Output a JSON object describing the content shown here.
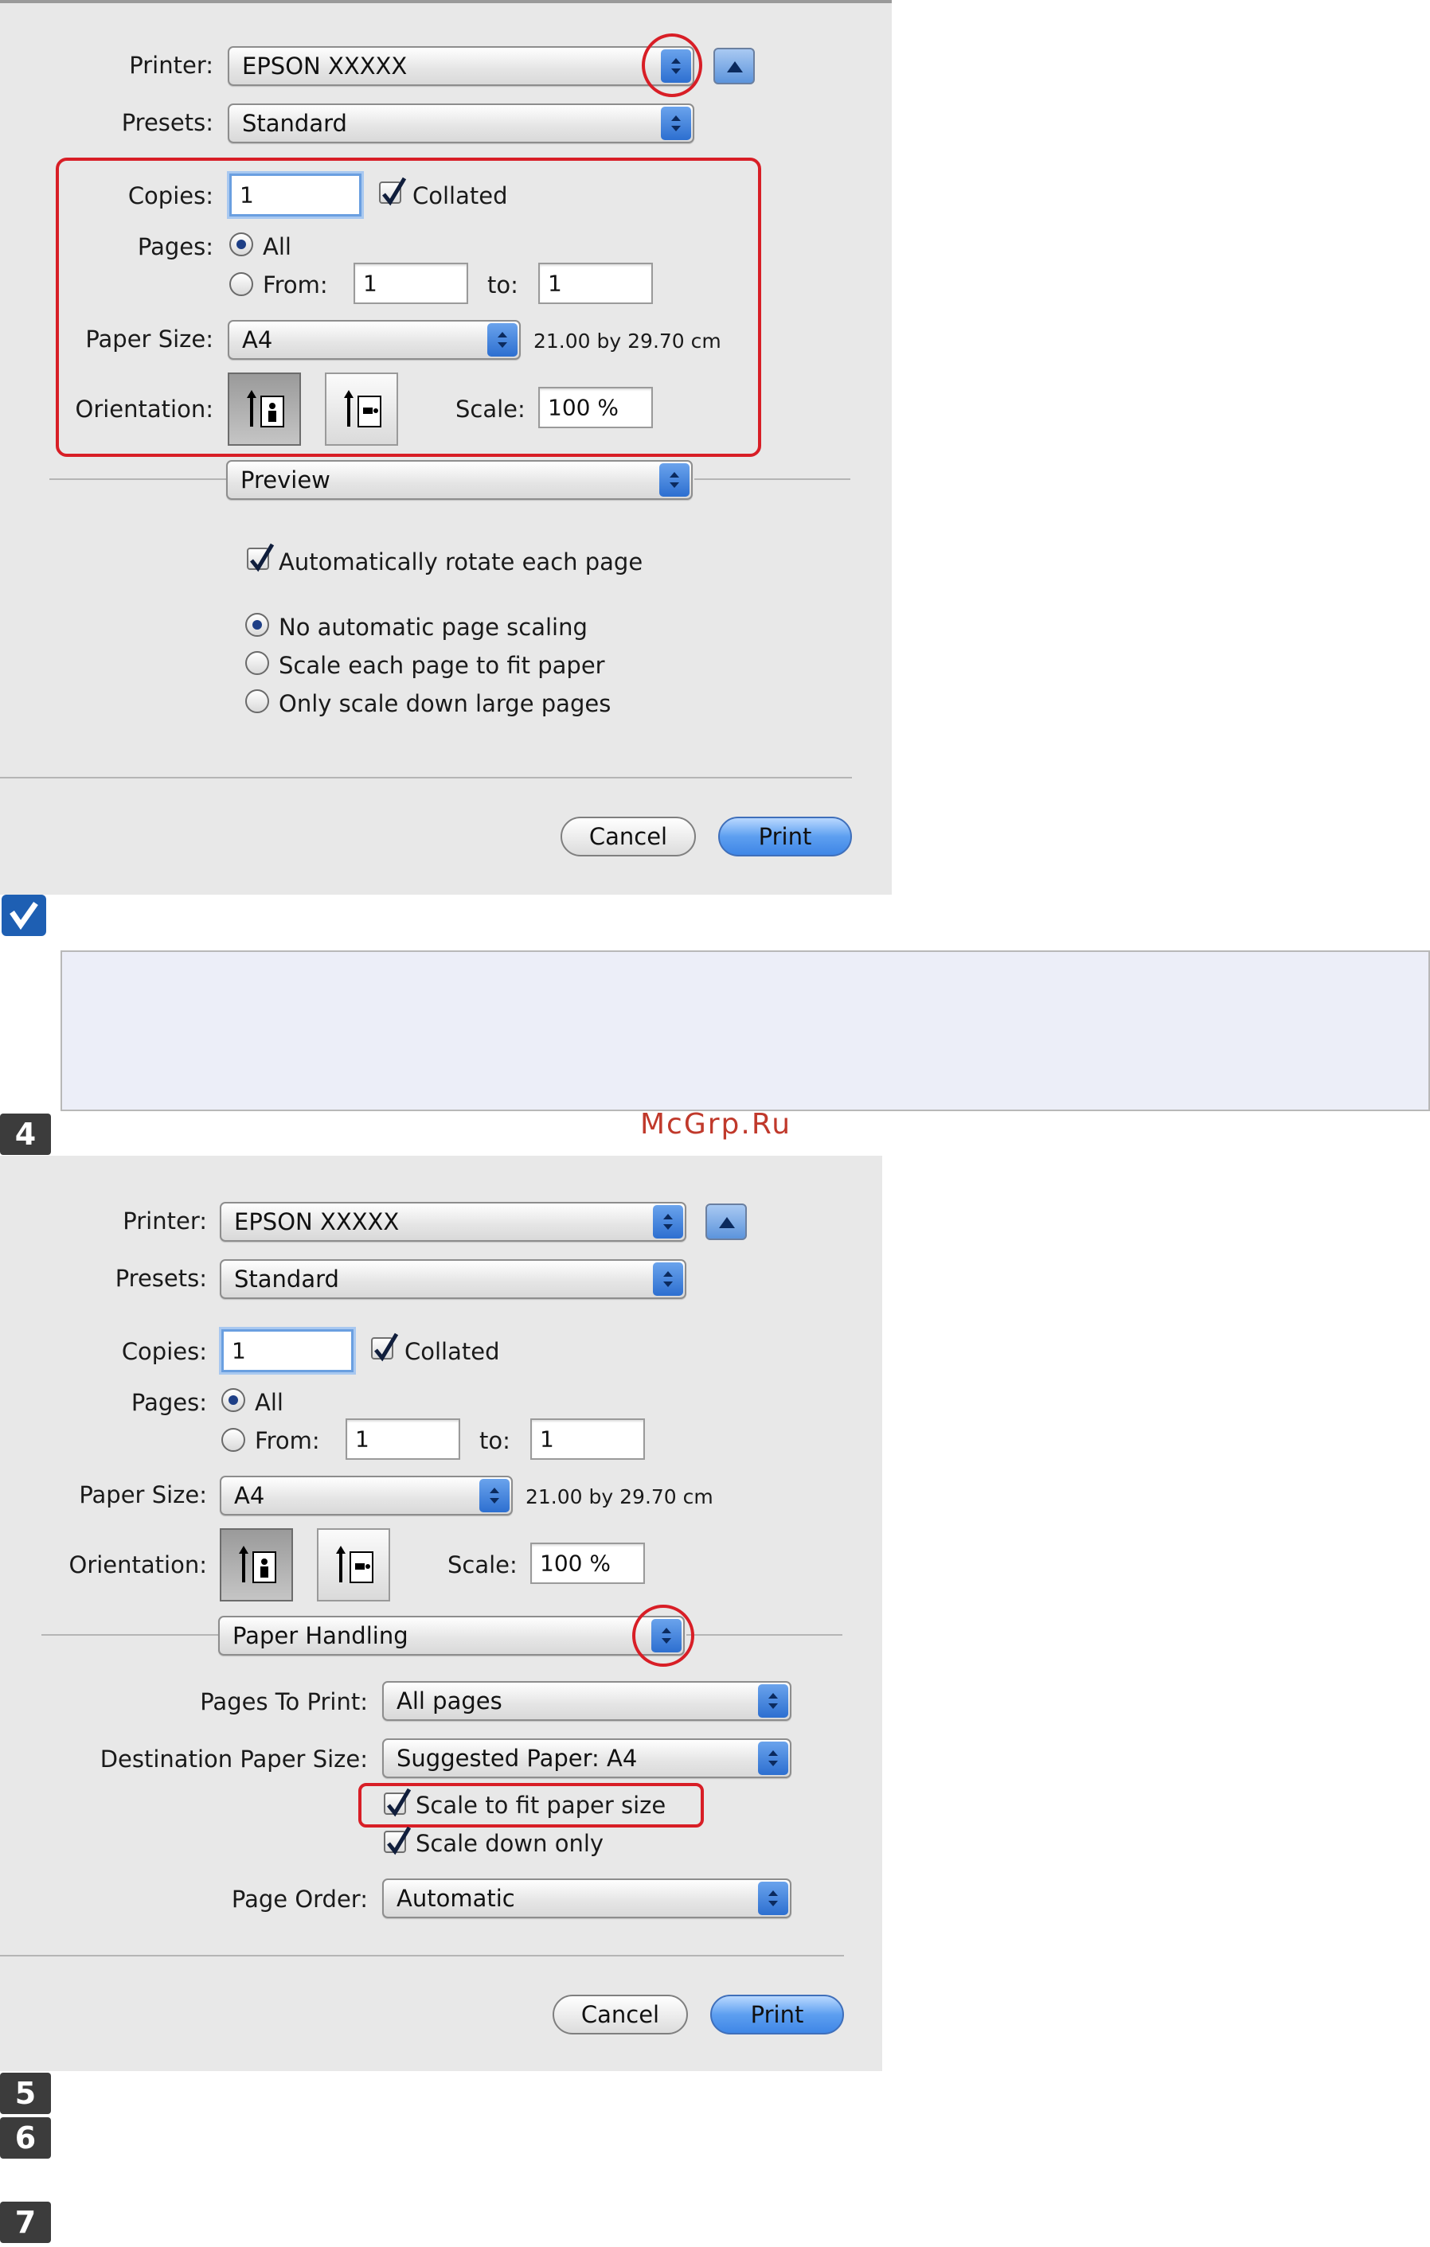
{
  "dialog1": {
    "printer_label": "Printer:",
    "printer_value": "EPSON XXXXX",
    "presets_label": "Presets:",
    "presets_value": "Standard",
    "copies_label": "Copies:",
    "copies_value": "1",
    "collated_label": "Collated",
    "pages_label": "Pages:",
    "all_label": "All",
    "from_label": "From:",
    "from_value": "1",
    "to_label": "to:",
    "to_value": "1",
    "paper_size_label": "Paper Size:",
    "paper_size_value": "A4",
    "paper_dims": "21.00 by 29.70 cm",
    "orientation_label": "Orientation:",
    "scale_label": "Scale:",
    "scale_value": "100 %",
    "section_popup": "Preview",
    "auto_rotate_label": "Automatically rotate each page",
    "scaling_options": [
      "No automatic page scaling",
      "Scale each page to fit paper",
      "Only scale down large pages"
    ],
    "cancel_label": "Cancel",
    "print_label": "Print"
  },
  "dialog2": {
    "printer_label": "Printer:",
    "printer_value": "EPSON XXXXX",
    "presets_label": "Presets:",
    "presets_value": "Standard",
    "copies_label": "Copies:",
    "copies_value": "1",
    "collated_label": "Collated",
    "pages_label": "Pages:",
    "all_label": "All",
    "from_label": "From:",
    "from_value": "1",
    "to_label": "to:",
    "to_value": "1",
    "paper_size_label": "Paper Size:",
    "paper_size_value": "A4",
    "paper_dims": "21.00 by 29.70 cm",
    "orientation_label": "Orientation:",
    "scale_label": "Scale:",
    "scale_value": "100 %",
    "section_popup": "Paper Handling",
    "pages_to_print_label": "Pages To Print:",
    "pages_to_print_value": "All pages",
    "dest_paper_label": "Destination Paper Size:",
    "dest_paper_value": "Suggested Paper: A4",
    "scale_fit_label": "Scale to fit paper size",
    "scale_down_label": "Scale down only",
    "page_order_label": "Page Order:",
    "page_order_value": "Automatic",
    "cancel_label": "Cancel",
    "print_label": "Print"
  },
  "steps": {
    "step4": "4",
    "step5": "5",
    "step6": "6",
    "step7": "7"
  },
  "watermark": "McGrp.Ru",
  "colors": {
    "highlight_red": "#d81e26",
    "dialog_bg": "#e8e8e8",
    "accent_blue": "#3f86e6",
    "note_bg": "#eceef8"
  }
}
